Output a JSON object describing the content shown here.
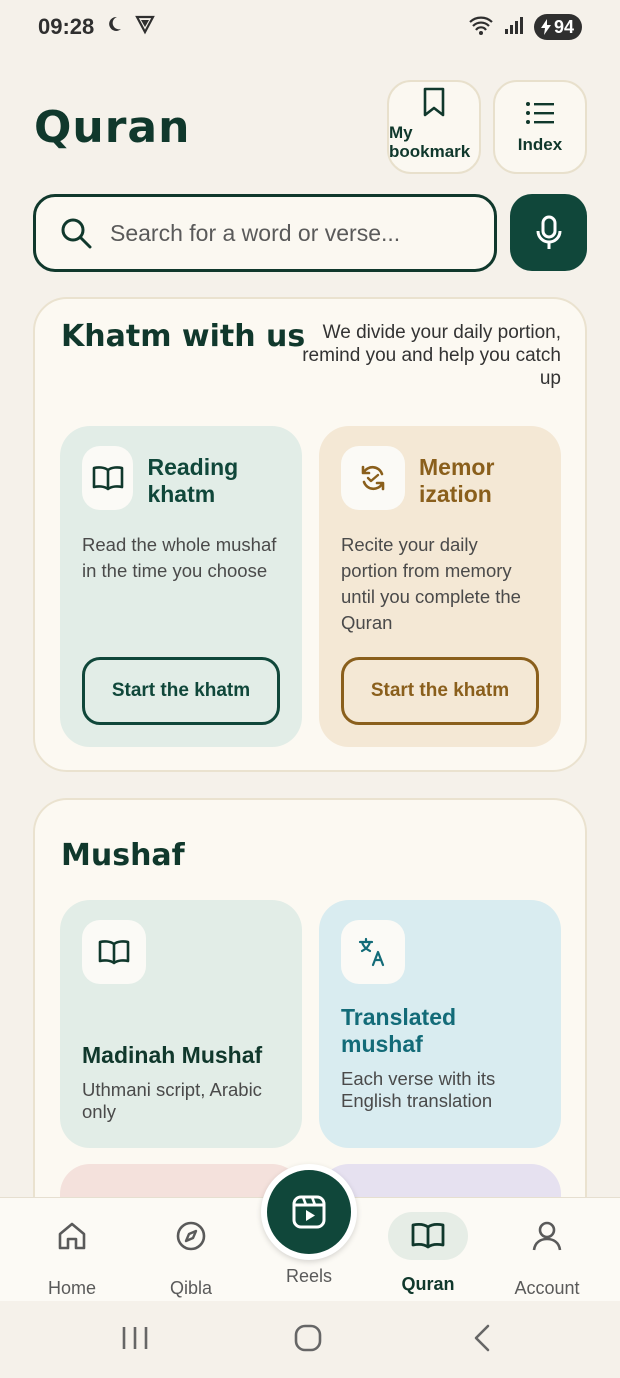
{
  "status_bar": {
    "time": "09:28",
    "battery": "94"
  },
  "header": {
    "title": "Quran",
    "bookmark_label": "My bookmark",
    "index_label": "Index"
  },
  "search": {
    "placeholder": "Search for a word or verse..."
  },
  "khatm": {
    "title": "Khatm with us",
    "description": "We divide your daily portion, remind you and help you catch up",
    "reading": {
      "name": "Reading khatm",
      "text": "Read the whole mushaf in the time you choose",
      "button": "Start the khatm"
    },
    "memorization": {
      "name": "Memor ization",
      "text": "Recite your daily portion from memory until you complete the Quran",
      "button": "Start the khatm"
    }
  },
  "mushaf": {
    "title": "Mushaf",
    "madinah": {
      "name": "Madinah Mushaf",
      "text": "Uthmani script, Arabic only"
    },
    "translated": {
      "name": "Translated mushaf",
      "text": "Each verse with its English translation"
    }
  },
  "nav": {
    "home": "Home",
    "qibla": "Qibla",
    "reels": "Reels",
    "quran": "Quran",
    "account": "Account",
    "active": "Quran"
  },
  "colors": {
    "primary": "#10473a",
    "background": "#f5f1ea",
    "gold": "#8a5f1c",
    "teal": "#136b78"
  }
}
